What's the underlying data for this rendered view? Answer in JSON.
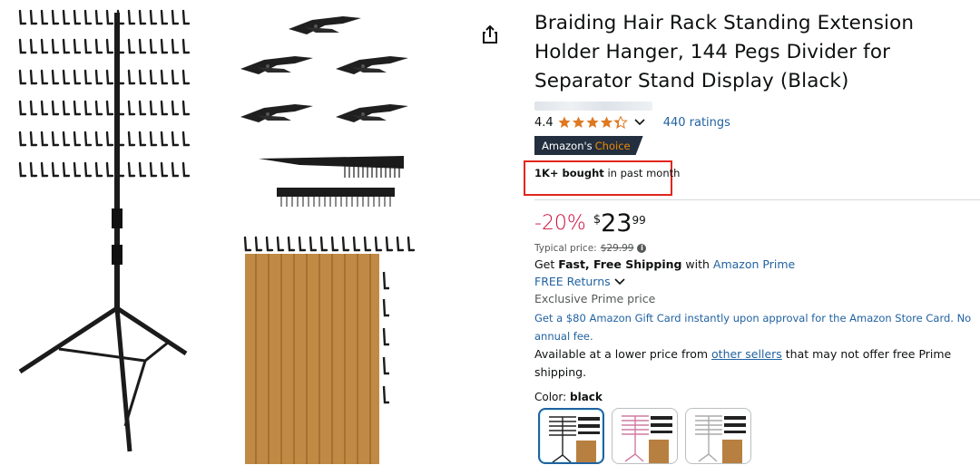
{
  "product": {
    "title": "Braiding Hair Rack Standing Extension Holder Hanger, 144 Pegs Divider for Separator Stand Display (Black)",
    "rating": "4.4",
    "ratings_count": "440 ratings",
    "badge_prefix": "Amazon's",
    "badge_suffix": "Choice",
    "bought_bold": "1K+ bought",
    "bought_rest": " in past month"
  },
  "price": {
    "discount": "-20%",
    "symbol": "$",
    "whole": "23",
    "fraction": "99",
    "typical_label": "Typical price:",
    "typical_value": "$29.99"
  },
  "shipping": {
    "get": "Get ",
    "fast_free": "Fast, Free Shipping",
    "with": " with ",
    "prime": "Amazon Prime",
    "free_returns": "FREE Returns",
    "exclusive": "Exclusive Prime price",
    "gift_card": "Get a $80 Amazon Gift Card instantly upon approval for the Amazon Store Card. No annual fee.",
    "lower_price_a": "Available at a lower price from ",
    "lower_price_link": "other sellers",
    "lower_price_b": " that may not offer free Prime shipping."
  },
  "color": {
    "label": "Color: ",
    "value": "black"
  },
  "icons": [
    "share-icon",
    "star-icon",
    "chevron-down-icon",
    "info-icon"
  ],
  "colors": {
    "accent_blue": "#2162a1",
    "discount_red": "#cc0c39",
    "star": "#de7921",
    "badge_bg": "#232f3e",
    "highlight": "#e1261c"
  }
}
